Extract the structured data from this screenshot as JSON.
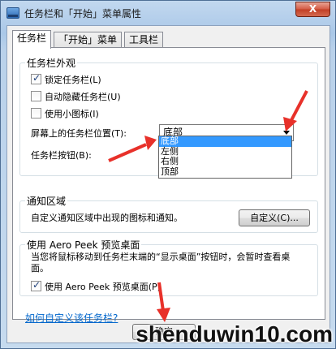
{
  "window": {
    "title": "任务栏和「开始」菜单属性",
    "close_label": "X"
  },
  "tabs": [
    {
      "label": "任务栏",
      "active": true
    },
    {
      "label": "「开始」菜单",
      "active": false
    },
    {
      "label": "工具栏",
      "active": false
    }
  ],
  "appearance": {
    "group_title": "任务栏外观",
    "lock_taskbar": {
      "label": "锁定任务栏(L)",
      "checked": true
    },
    "auto_hide": {
      "label": "自动隐藏任务栏(U)",
      "checked": false
    },
    "small_icons": {
      "label": "使用小图标(I)",
      "checked": false
    },
    "location_label": "屏幕上的任务栏位置(T):",
    "location_value": "底部",
    "location_options": [
      "底部",
      "左侧",
      "右侧",
      "顶部"
    ],
    "buttons_label": "任务栏按钮(B):"
  },
  "notification": {
    "group_title": "通知区域",
    "description": "自定义通知区域中出现的图标和通知。",
    "customize_button": "自定义(C)..."
  },
  "aero_peek": {
    "group_title": "使用 Aero Peek 预览桌面",
    "description": "当您将鼠标移动到任务栏末端的“显示桌面”按钮时，会暂时查看桌面。",
    "use_peek": {
      "label": "使用 Aero Peek 预览桌面(P)",
      "checked": true
    }
  },
  "help_link": "如何自定义该任务栏?",
  "footer": {
    "ok_button": "确定"
  },
  "watermark": "shenduwin10.com",
  "colors": {
    "annotation_arrow": "#e8312a",
    "selection": "#3399ff",
    "link": "#0066cc"
  }
}
